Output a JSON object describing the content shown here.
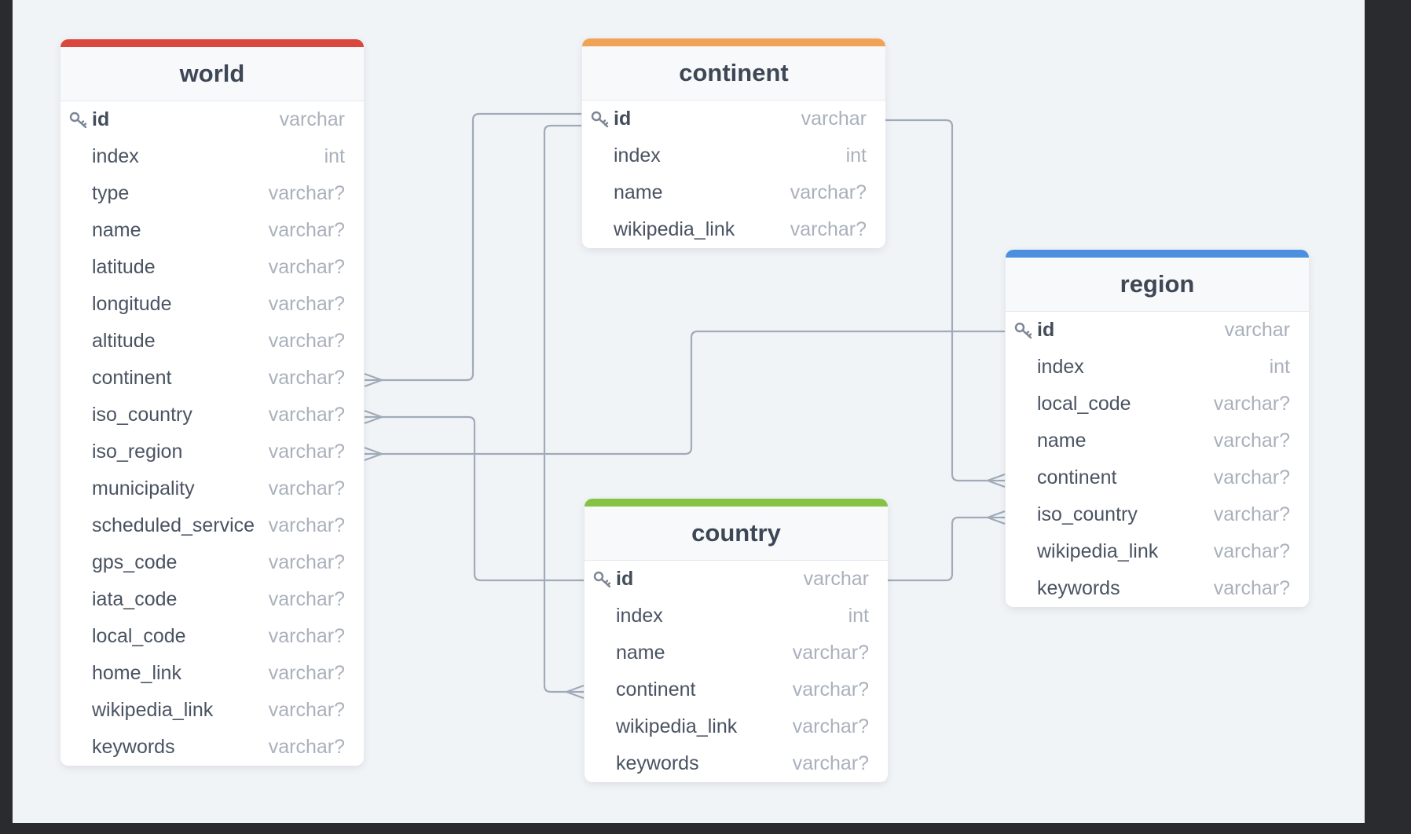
{
  "colors": {
    "world": "#d9473e",
    "continent": "#f0a256",
    "country": "#86c243",
    "region": "#4b8fde",
    "link": "#a0aab8"
  },
  "relations": [
    {
      "from": "world.continent",
      "to": "continent.id",
      "cardinality": "many-to-one"
    },
    {
      "from": "world.iso_country",
      "to": "country.id",
      "cardinality": "many-to-one"
    },
    {
      "from": "world.iso_region",
      "to": "region.id",
      "cardinality": "many-to-one"
    },
    {
      "from": "country.continent",
      "to": "continent.id",
      "cardinality": "many-to-one"
    },
    {
      "from": "region.continent",
      "to": "continent.id",
      "cardinality": "many-to-one"
    },
    {
      "from": "region.iso_country",
      "to": "country.id",
      "cardinality": "many-to-one"
    }
  ],
  "tables": {
    "world": {
      "title": "world",
      "fields": [
        {
          "name": "id",
          "type": "varchar",
          "pk": true
        },
        {
          "name": "index",
          "type": "int"
        },
        {
          "name": "type",
          "type": "varchar?"
        },
        {
          "name": "name",
          "type": "varchar?"
        },
        {
          "name": "latitude",
          "type": "varchar?"
        },
        {
          "name": "longitude",
          "type": "varchar?"
        },
        {
          "name": "altitude",
          "type": "varchar?"
        },
        {
          "name": "continent",
          "type": "varchar?"
        },
        {
          "name": "iso_country",
          "type": "varchar?"
        },
        {
          "name": "iso_region",
          "type": "varchar?"
        },
        {
          "name": "municipality",
          "type": "varchar?"
        },
        {
          "name": "scheduled_service",
          "type": "varchar?"
        },
        {
          "name": "gps_code",
          "type": "varchar?"
        },
        {
          "name": "iata_code",
          "type": "varchar?"
        },
        {
          "name": "local_code",
          "type": "varchar?"
        },
        {
          "name": "home_link",
          "type": "varchar?"
        },
        {
          "name": "wikipedia_link",
          "type": "varchar?"
        },
        {
          "name": "keywords",
          "type": "varchar?"
        }
      ]
    },
    "continent": {
      "title": "continent",
      "fields": [
        {
          "name": "id",
          "type": "varchar",
          "pk": true
        },
        {
          "name": "index",
          "type": "int"
        },
        {
          "name": "name",
          "type": "varchar?"
        },
        {
          "name": "wikipedia_link",
          "type": "varchar?"
        }
      ]
    },
    "country": {
      "title": "country",
      "fields": [
        {
          "name": "id",
          "type": "varchar",
          "pk": true
        },
        {
          "name": "index",
          "type": "int"
        },
        {
          "name": "name",
          "type": "varchar?"
        },
        {
          "name": "continent",
          "type": "varchar?"
        },
        {
          "name": "wikipedia_link",
          "type": "varchar?"
        },
        {
          "name": "keywords",
          "type": "varchar?"
        }
      ]
    },
    "region": {
      "title": "region",
      "fields": [
        {
          "name": "id",
          "type": "varchar",
          "pk": true
        },
        {
          "name": "index",
          "type": "int"
        },
        {
          "name": "local_code",
          "type": "varchar?"
        },
        {
          "name": "name",
          "type": "varchar?"
        },
        {
          "name": "continent",
          "type": "varchar?"
        },
        {
          "name": "iso_country",
          "type": "varchar?"
        },
        {
          "name": "wikipedia_link",
          "type": "varchar?"
        },
        {
          "name": "keywords",
          "type": "varchar?"
        }
      ]
    }
  }
}
